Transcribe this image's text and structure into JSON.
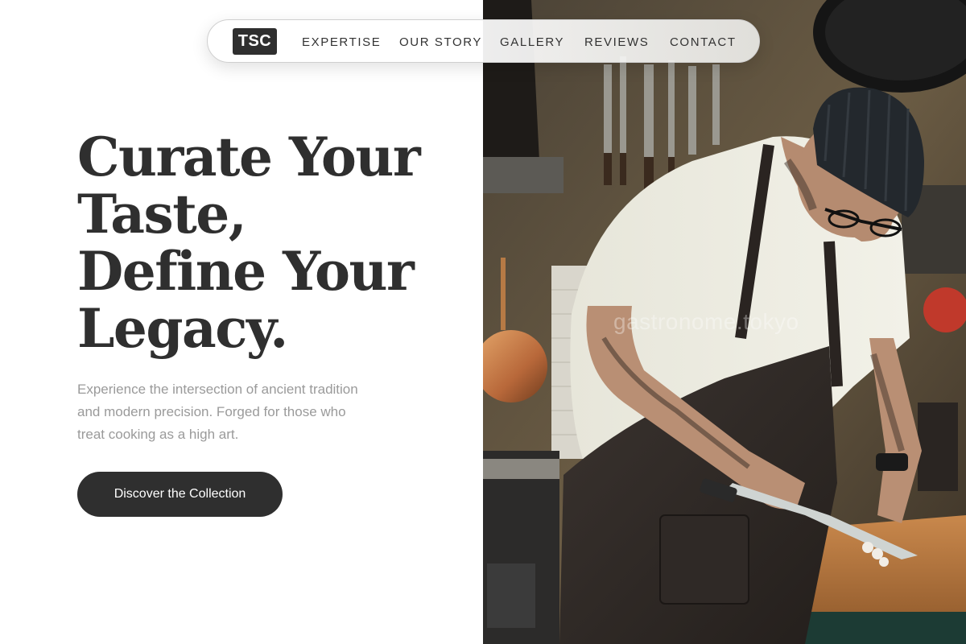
{
  "nav": {
    "logo": "TSC",
    "links": [
      "EXPERTISE",
      "OUR STORY",
      "GALLERY",
      "REVIEWS",
      "CONTACT"
    ]
  },
  "hero": {
    "title_lines": [
      "Curate Your",
      "Taste,",
      "Define Your",
      "Legacy."
    ],
    "description_lines": [
      "Experience the intersection of ancient tradition",
      "and modern precision. Forged for those who",
      "treat cooking as a high art."
    ],
    "cta_label": "Discover the Collection"
  },
  "image": {
    "watermark": "gastronome.tokyo"
  },
  "colors": {
    "text_dark": "#2f2f2f",
    "text_muted": "#9a9a9a",
    "background": "#ffffff"
  }
}
